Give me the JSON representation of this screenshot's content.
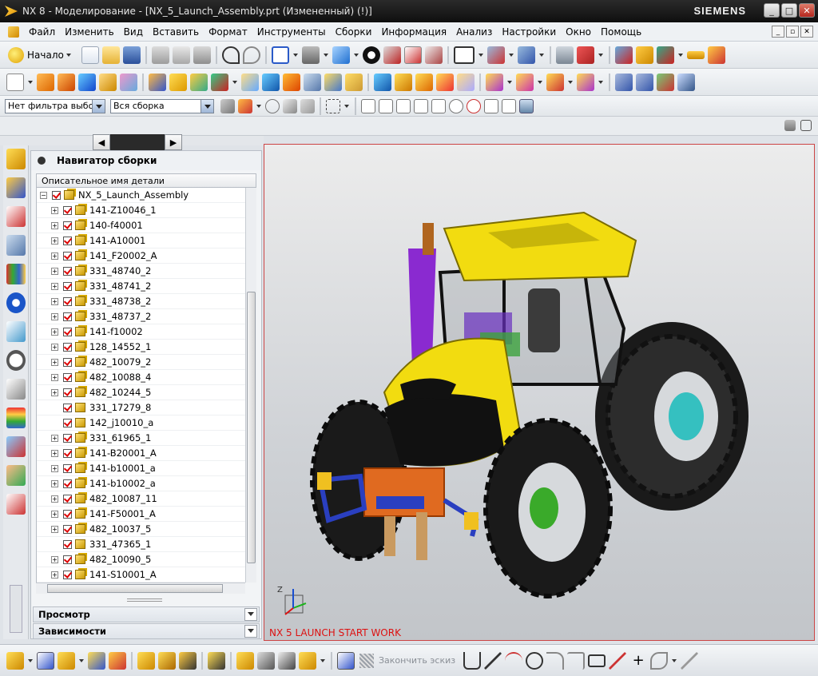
{
  "window": {
    "title": "NX 8 - Моделирование - [NX_5_Launch_Assembly.prt (Измененный)     (!)]",
    "brand": "SIEMENS",
    "controls": [
      "_",
      "□",
      "✕"
    ]
  },
  "menu": {
    "items": [
      "Файл",
      "Изменить",
      "Вид",
      "Вставить",
      "Формат",
      "Инструменты",
      "Сборки",
      "Информация",
      "Анализ",
      "Настройки",
      "Окно",
      "Помощь"
    ]
  },
  "toolbar": {
    "start_label": "Начало",
    "filter_value": "Нет фильтра выбо",
    "scope_value": "Вся сборка",
    "finish_sketch_label": "Закончить эскиз"
  },
  "navigator": {
    "title": "Навигатор сборки",
    "column_header": "Описательное имя детали",
    "root": "NX_5_Launch_Assembly",
    "items": [
      {
        "name": "141-Z10046_1",
        "expandable": true
      },
      {
        "name": "140-f40001",
        "expandable": true
      },
      {
        "name": "141-A10001",
        "expandable": true
      },
      {
        "name": "141_F20002_A",
        "expandable": true
      },
      {
        "name": "331_48740_2",
        "expandable": true
      },
      {
        "name": "331_48741_2",
        "expandable": true
      },
      {
        "name": "331_48738_2",
        "expandable": true
      },
      {
        "name": "331_48737_2",
        "expandable": true
      },
      {
        "name": "141-f10002",
        "expandable": true
      },
      {
        "name": "128_14552_1",
        "expandable": true
      },
      {
        "name": "482_10079_2",
        "expandable": true
      },
      {
        "name": "482_10088_4",
        "expandable": true
      },
      {
        "name": "482_10244_5",
        "expandable": true
      },
      {
        "name": "331_17279_8",
        "expandable": false
      },
      {
        "name": "142_j10010_a",
        "expandable": false
      },
      {
        "name": "331_61965_1",
        "expandable": true
      },
      {
        "name": "141-B20001_A",
        "expandable": true
      },
      {
        "name": "141-b10001_a",
        "expandable": true
      },
      {
        "name": "141-b10002_a",
        "expandable": true
      },
      {
        "name": "482_10087_11",
        "expandable": true
      },
      {
        "name": "141-F50001_A",
        "expandable": true
      },
      {
        "name": "482_10037_5",
        "expandable": true
      },
      {
        "name": "331_47365_1",
        "expandable": false
      },
      {
        "name": "482_10090_5",
        "expandable": true
      },
      {
        "name": "141-S10001_A",
        "expandable": true
      }
    ],
    "panels": [
      "Просмотр",
      "Зависимости"
    ]
  },
  "viewport": {
    "wcs_label": "NX 5 LAUNCH START WORK",
    "triad_axis": "Z",
    "body_color": "#f2dc10",
    "accent_color": "#8a2ad0"
  }
}
